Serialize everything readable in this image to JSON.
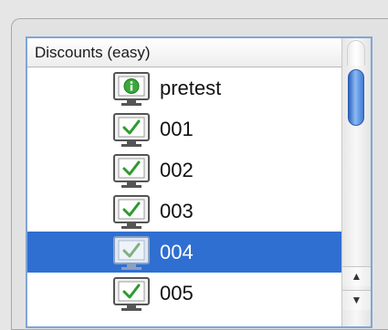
{
  "list": {
    "header": "Discounts (easy)",
    "rows": [
      {
        "label": "pretest",
        "icon": "info-monitor-icon",
        "selected": false
      },
      {
        "label": "001",
        "icon": "checked-monitor-icon",
        "selected": false
      },
      {
        "label": "002",
        "icon": "checked-monitor-icon",
        "selected": false
      },
      {
        "label": "003",
        "icon": "checked-monitor-icon",
        "selected": false
      },
      {
        "label": "004",
        "icon": "checked-monitor-icon",
        "selected": true
      },
      {
        "label": "005",
        "icon": "checked-monitor-icon",
        "selected": false
      }
    ]
  },
  "scrollbar": {
    "up_arrow": "▲",
    "down_arrow": "▼"
  },
  "colors": {
    "selection": "#2f6fd2",
    "focus_ring": "#7fa6d6",
    "check_green": "#2e9a2e",
    "info_green": "#3aa83a"
  }
}
